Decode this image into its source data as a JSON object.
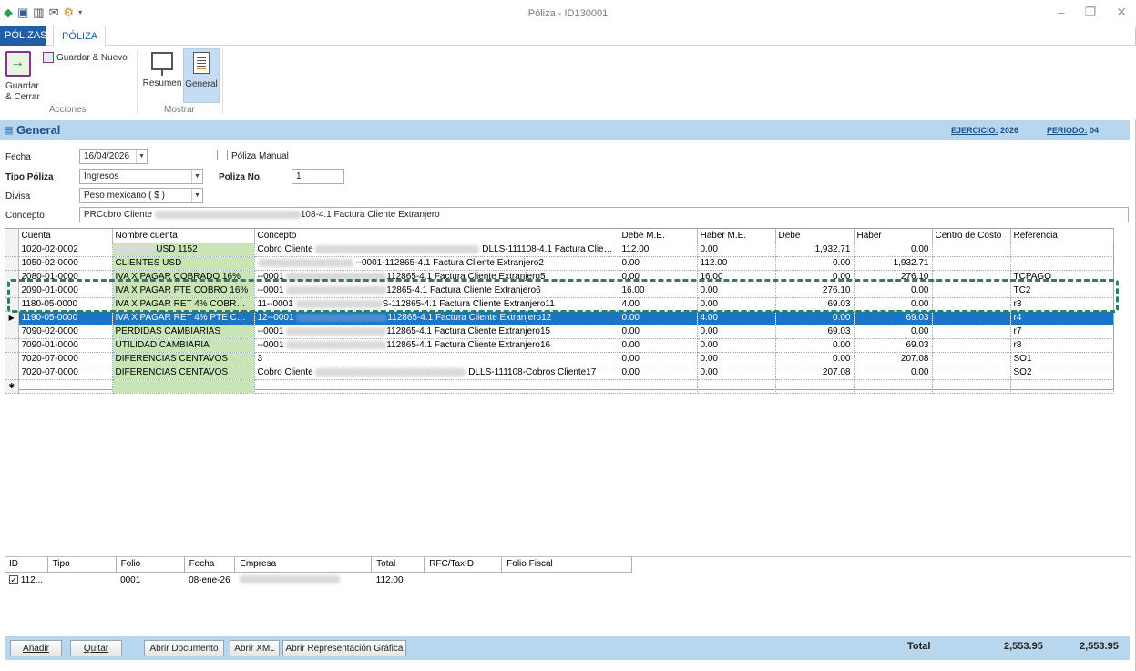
{
  "window": {
    "title": "Póliza - ID130001"
  },
  "tabs": {
    "polizas": "PÓLIZAS",
    "poliza": "PÓLIZA"
  },
  "ribbon": {
    "guardar_cerrar": "Guardar & Cerrar",
    "guardar_nuevo": "Guardar & Nuevo",
    "group_acciones": "Acciones",
    "resumen": "Resumen",
    "general": "General",
    "group_mostrar": "Mostrar"
  },
  "section": {
    "title": "General",
    "ejercicio_label": "EJERCICIO:",
    "ejercicio_value": "2026",
    "periodo_label": "PERIODO:",
    "periodo_value": "04"
  },
  "form": {
    "fecha_label": "Fecha",
    "fecha_value": "16/04/2026",
    "poliza_manual_label": "Póliza Manual",
    "tipo_label": "Tipo Póliza",
    "tipo_value": "Ingresos",
    "poliza_no_label": "Poliza No.",
    "poliza_no_value": "1",
    "divisa_label": "Divisa",
    "divisa_value": "Peso mexicano ( $ )",
    "concepto_label": "Concepto",
    "concepto_pre": "PRCobro Cliente",
    "concepto_post": "108-4.1 Factura Cliente Extranjero"
  },
  "grid": {
    "columns": [
      "Cuenta",
      "Nombre cuenta",
      "Concepto",
      "Debe M.E.",
      "Haber M.E.",
      "Debe",
      "Haber",
      "Centro de Costo",
      "Referencia"
    ],
    "rows": [
      {
        "cuenta": "1020-02-0002",
        "nombre": "USD 1152",
        "concepto_pre": "Cobro Cliente",
        "concepto_post": "DLLS-111108-4.1 Factura Cliente ...",
        "debe_me": "112.00",
        "haber_me": "0.00",
        "debe": "1,932.71",
        "haber": "0.00",
        "centro": "",
        "ref": ""
      },
      {
        "cuenta": "1050-02-0000",
        "nombre": "CLIENTES USD",
        "concepto_pre": "",
        "concepto_post": "--0001-112865-4.1 Factura Cliente Extranjero2",
        "debe_me": "0.00",
        "haber_me": "112.00",
        "debe": "0.00",
        "haber": "1,932.71",
        "centro": "",
        "ref": ""
      },
      {
        "cuenta": "2080-01-0000",
        "nombre": "IVA X PAGAR COBRADO 16%",
        "concepto_pre": "--0001",
        "concepto_post": "112865-4.1 Factura Cliente Extranjero5",
        "debe_me": "0.00",
        "haber_me": "16.00",
        "debe": "0.00",
        "haber": "276.10",
        "centro": "",
        "ref": "TCPAGO"
      },
      {
        "cuenta": "2090-01-0000",
        "nombre": "IVA X PAGAR PTE COBRO 16%",
        "concepto_pre": "--0001",
        "concepto_post": "12865-4.1 Factura Cliente Extranjero6",
        "debe_me": "16.00",
        "haber_me": "0.00",
        "debe": "276.10",
        "haber": "0.00",
        "centro": "",
        "ref": "TC2"
      },
      {
        "cuenta": "1180-05-0000",
        "nombre": "IVA X PAGAR RET 4% COBRADO",
        "concepto_pre": "11--0001",
        "concepto_post": "S-112865-4.1 Factura Cliente Extranjero11",
        "debe_me": "4.00",
        "haber_me": "0.00",
        "debe": "69.03",
        "haber": "0.00",
        "centro": "",
        "ref": "r3"
      },
      {
        "cuenta": "1190-05-0000",
        "nombre": "IVA X PAGAR RET 4% PTE COBRO",
        "concepto_pre": "12--0001",
        "concepto_post": "112865-4.1 Factura Cliente Extranjero12",
        "debe_me": "0.00",
        "haber_me": "4.00",
        "debe": "0.00",
        "haber": "69.03",
        "centro": "",
        "ref": "r4"
      },
      {
        "cuenta": "7090-02-0000",
        "nombre": "PERDIDAS CAMBIARIAS",
        "concepto_pre": "--0001",
        "concepto_post": "112865-4.1 Factura Cliente Extranjero15",
        "debe_me": "0.00",
        "haber_me": "0.00",
        "debe": "69.03",
        "haber": "0.00",
        "centro": "",
        "ref": "r7"
      },
      {
        "cuenta": "7090-01-0000",
        "nombre": "UTILIDAD CAMBIARIA",
        "concepto_pre": "--0001",
        "concepto_post": "112865-4.1 Factura Cliente Extranjero16",
        "debe_me": "0.00",
        "haber_me": "0.00",
        "debe": "0.00",
        "haber": "69.03",
        "centro": "",
        "ref": "r8"
      },
      {
        "cuenta": "7020-07-0000",
        "nombre": "DIFERENCIAS CENTAVOS",
        "concepto_pre": "3",
        "concepto_post": "",
        "debe_me": "0.00",
        "haber_me": "0.00",
        "debe": "0.00",
        "haber": "207.08",
        "centro": "",
        "ref": "SO1"
      },
      {
        "cuenta": "7020-07-0000",
        "nombre": "DIFERENCIAS CENTAVOS",
        "concepto_pre": "Cobro Cliente",
        "concepto_post": "DLLS-111108-Cobros Cliente17",
        "debe_me": "0.00",
        "haber_me": "0.00",
        "debe": "207.08",
        "haber": "0.00",
        "centro": "",
        "ref": "SO2"
      }
    ]
  },
  "docs": {
    "columns": [
      "ID",
      "Tipo",
      "Folio",
      "Fecha",
      "Empresa",
      "Total",
      "RFC/TaxID",
      "Folio Fiscal"
    ],
    "rows": [
      {
        "id": "112...",
        "tipo": "",
        "folio": "0001",
        "fecha": "08-ene-26",
        "empresa": "",
        "total": "112.00",
        "rfc": "",
        "folio_fiscal": ""
      }
    ]
  },
  "footer": {
    "anadir": "Añadir",
    "quitar": "Quitar",
    "abrir_documento": "Abrir Documento",
    "abrir_xml": "Abrir XML",
    "abrir_representacion": "Abrir Representación Gráfica",
    "total_label": "Total",
    "total_debe": "2,553.95",
    "total_haber": "2,553.95"
  }
}
